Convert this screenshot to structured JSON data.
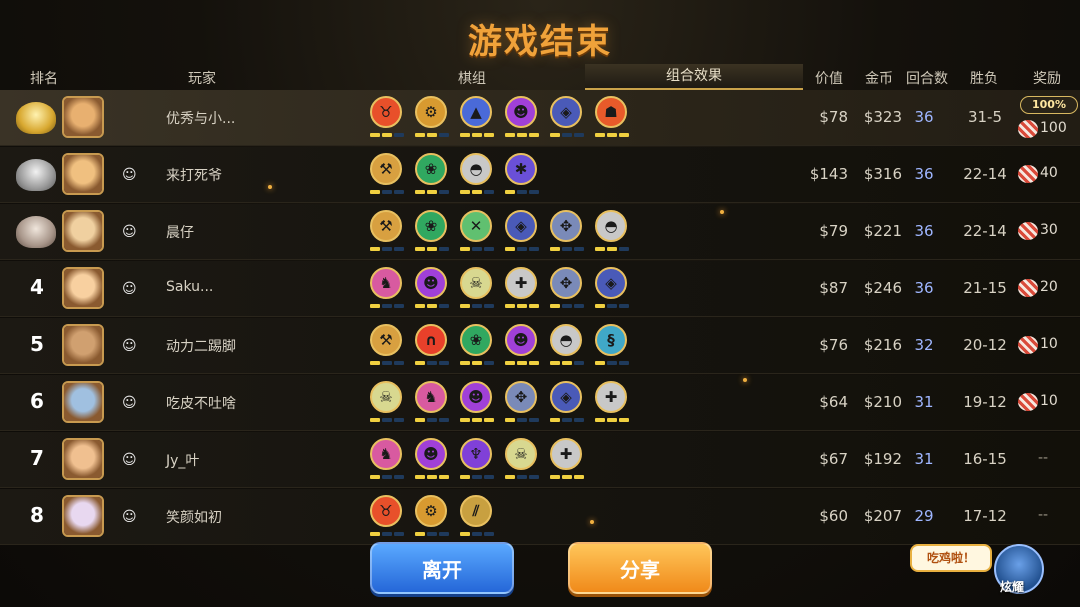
{
  "title": "游戏结束",
  "headers": {
    "rank": "排名",
    "player": "玩家",
    "lineup": "棋组",
    "combo": "组合效果",
    "value": "价值",
    "gold": "金币",
    "rounds": "回合数",
    "winloss": "胜负",
    "reward": "奖励"
  },
  "reward_bonus": "100%",
  "players": [
    {
      "rank": "1",
      "name": "优秀与小...",
      "value": "$78",
      "gold": "$323",
      "rounds": "36",
      "wl": "31-5",
      "reward": "100",
      "me": true,
      "synergies": [
        {
          "icon": "demon-horns-icon",
          "color": "#e8502a",
          "bars": [
            1,
            1,
            0
          ]
        },
        {
          "icon": "gear-icon",
          "color": "#d89a30",
          "bars": [
            1,
            1,
            0
          ]
        },
        {
          "icon": "wizard-hat-icon",
          "color": "#4a6ad8",
          "bars": [
            1,
            1,
            1
          ]
        },
        {
          "icon": "demon-face-icon",
          "color": "#a040d8",
          "bars": [
            1,
            1,
            1
          ]
        },
        {
          "icon": "crystal-icon",
          "color": "#4a5ab8",
          "bars": [
            1,
            0,
            0
          ]
        },
        {
          "icon": "beast-head-icon",
          "color": "#e85a2a",
          "bars": [
            1,
            1,
            1
          ]
        }
      ]
    },
    {
      "rank": "2",
      "name": "来打死爷",
      "value": "$143",
      "gold": "$316",
      "rounds": "36",
      "wl": "22-14",
      "reward": "40",
      "synergies": [
        {
          "icon": "axe-icon",
          "color": "#d8a040",
          "bars": [
            1,
            0,
            0
          ]
        },
        {
          "icon": "paw-icon",
          "color": "#30a860",
          "bars": [
            1,
            1,
            0
          ]
        },
        {
          "icon": "helmet-icon",
          "color": "#c8c8c8",
          "bars": [
            1,
            1,
            0
          ]
        },
        {
          "icon": "fishbone-icon",
          "color": "#6a50d8",
          "bars": [
            1,
            0,
            0
          ]
        }
      ]
    },
    {
      "rank": "3",
      "name": "晨仔",
      "value": "$79",
      "gold": "$221",
      "rounds": "36",
      "wl": "22-14",
      "reward": "30",
      "synergies": [
        {
          "icon": "axe-icon",
          "color": "#d8a040",
          "bars": [
            1,
            0,
            0
          ]
        },
        {
          "icon": "paw-icon",
          "color": "#30a860",
          "bars": [
            1,
            1,
            0
          ]
        },
        {
          "icon": "cross-arrows-icon",
          "color": "#60c070",
          "bars": [
            1,
            0,
            0
          ]
        },
        {
          "icon": "crystal-icon",
          "color": "#4a5ab8",
          "bars": [
            1,
            0,
            0
          ]
        },
        {
          "icon": "claw-icon",
          "color": "#7a8ab8",
          "bars": [
            1,
            0,
            0
          ]
        },
        {
          "icon": "helmet-icon",
          "color": "#c8c8c8",
          "bars": [
            1,
            1,
            0
          ]
        }
      ]
    },
    {
      "rank": "4",
      "name": "Saku...",
      "value": "$87",
      "gold": "$246",
      "rounds": "36",
      "wl": "21-15",
      "reward": "20",
      "synergies": [
        {
          "icon": "knight-icon",
          "color": "#d85aa0",
          "bars": [
            1,
            0,
            0
          ]
        },
        {
          "icon": "demon-face-icon",
          "color": "#a040d8",
          "bars": [
            1,
            1,
            0
          ]
        },
        {
          "icon": "skull-icon",
          "color": "#d8d890",
          "bars": [
            1,
            0,
            0
          ]
        },
        {
          "icon": "plus-icon",
          "color": "#c8c8c8",
          "bars": [
            1,
            1,
            1
          ]
        },
        {
          "icon": "claw-icon",
          "color": "#7a8ab8",
          "bars": [
            1,
            0,
            0
          ]
        },
        {
          "icon": "crystal-icon",
          "color": "#4a5ab8",
          "bars": [
            1,
            0,
            0
          ]
        }
      ]
    },
    {
      "rank": "5",
      "name": "动力二踢脚",
      "value": "$76",
      "gold": "$216",
      "rounds": "32",
      "wl": "20-12",
      "reward": "10",
      "synergies": [
        {
          "icon": "axe-icon",
          "color": "#d8a040",
          "bars": [
            1,
            0,
            0
          ]
        },
        {
          "icon": "arch-icon",
          "color": "#e8402a",
          "bars": [
            1,
            0,
            0
          ]
        },
        {
          "icon": "paw-icon",
          "color": "#30a860",
          "bars": [
            1,
            1,
            0
          ]
        },
        {
          "icon": "demon-face-icon",
          "color": "#a040d8",
          "bars": [
            1,
            1,
            1
          ]
        },
        {
          "icon": "helmet-icon",
          "color": "#c8c8c8",
          "bars": [
            1,
            1,
            0
          ]
        },
        {
          "icon": "snake-icon",
          "color": "#40a8c8",
          "bars": [
            1,
            0,
            0
          ]
        }
      ]
    },
    {
      "rank": "6",
      "name": "吃皮不吐啥",
      "value": "$64",
      "gold": "$210",
      "rounds": "31",
      "wl": "19-12",
      "reward": "10",
      "synergies": [
        {
          "icon": "skull-icon",
          "color": "#d8d890",
          "bars": [
            1,
            0,
            0
          ]
        },
        {
          "icon": "knight-icon",
          "color": "#d85aa0",
          "bars": [
            1,
            0,
            0
          ]
        },
        {
          "icon": "demon-face-icon",
          "color": "#a040d8",
          "bars": [
            1,
            1,
            1
          ]
        },
        {
          "icon": "claw-icon",
          "color": "#7a8ab8",
          "bars": [
            1,
            0,
            0
          ]
        },
        {
          "icon": "crystal-icon",
          "color": "#4a5ab8",
          "bars": [
            1,
            0,
            0
          ]
        },
        {
          "icon": "plus-icon",
          "color": "#c8c8c8",
          "bars": [
            1,
            1,
            1
          ]
        }
      ]
    },
    {
      "rank": "7",
      "name": "Jy_叶",
      "value": "$67",
      "gold": "$192",
      "rounds": "31",
      "wl": "16-15",
      "reward": "--",
      "synergies": [
        {
          "icon": "knight-icon",
          "color": "#d85aa0",
          "bars": [
            1,
            0,
            0
          ]
        },
        {
          "icon": "demon-face-icon",
          "color": "#a040d8",
          "bars": [
            1,
            1,
            1
          ]
        },
        {
          "icon": "demon-hunter-icon",
          "color": "#8040d8",
          "bars": [
            1,
            0,
            0
          ]
        },
        {
          "icon": "skull-icon",
          "color": "#d8d890",
          "bars": [
            1,
            0,
            0
          ]
        },
        {
          "icon": "plus-icon",
          "color": "#c8c8c8",
          "bars": [
            1,
            1,
            1
          ]
        }
      ]
    },
    {
      "rank": "8",
      "name": "笑颜如初",
      "value": "$60",
      "gold": "$207",
      "rounds": "29",
      "wl": "17-12",
      "reward": "--",
      "synergies": [
        {
          "icon": "demon-horns-icon",
          "color": "#e8502a",
          "bars": [
            1,
            0,
            0
          ]
        },
        {
          "icon": "gear-icon",
          "color": "#d89a30",
          "bars": [
            1,
            0,
            0
          ]
        },
        {
          "icon": "blades-icon",
          "color": "#c8a040",
          "bars": [
            1,
            0,
            0
          ]
        }
      ]
    }
  ],
  "buttons": {
    "leave": "离开",
    "share": "分享"
  },
  "bubble_text": "吃鸡啦！",
  "mascot_label": "炫耀"
}
